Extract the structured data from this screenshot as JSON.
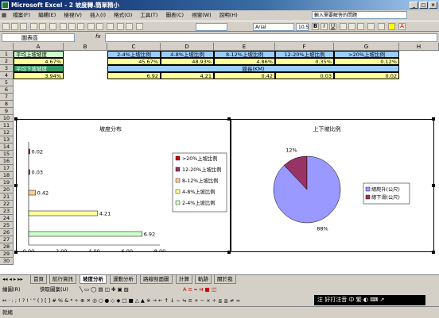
{
  "window": {
    "title": "Microsoft Excel - 2 坡度轉.簡單精小"
  },
  "menu": [
    "檔案(F)",
    "編輯(E)",
    "檢視(V)",
    "插入(I)",
    "格式(O)",
    "工具(T)",
    "圖表(C)",
    "視窗(W)",
    "說明(H)"
  ],
  "help_placeholder": "輸入需要解答的問題",
  "font": {
    "name": "Arial",
    "size": "10.5"
  },
  "namebox": "圖表區",
  "fx": "fx",
  "columns": [
    "A",
    "B",
    "C",
    "D",
    "E",
    "F",
    "G",
    "H"
  ],
  "rows": [
    "1",
    "2",
    "3",
    "4",
    "5",
    "6",
    "7",
    "8",
    "9",
    "10",
    "11",
    "12",
    "13",
    "14",
    "15",
    "16",
    "17",
    "18",
    "19",
    "20",
    "21",
    "22",
    "23",
    "24",
    "25",
    "26",
    "27",
    "28",
    "29",
    "30"
  ],
  "cells": {
    "a1": "平均上坡坡度",
    "a2": "4.67%",
    "a3": "平均下坡坡度",
    "a4": "3.94%",
    "c1": "2-4%上坡比例",
    "d1": "4-8%上坡比例",
    "e1": "8-12%上坡比例",
    "f1": "12-20%上坡比例",
    "g1": ">20%上坡比例",
    "c2": "45.67%",
    "d2": "48.93%",
    "e2": "4.86%",
    "f2": "0.35%",
    "g2": "0.12%",
    "e3": "總長(KM)",
    "c4": "6.92",
    "d4": "4.21",
    "e4": "0.42",
    "f4": "0.03",
    "g4": "0.02"
  },
  "chart_data": [
    {
      "type": "bar",
      "title": "坡度分布",
      "xlabel": "公里",
      "ylabel": "",
      "categories": [
        "2-4%上坡比例",
        "4-8%上坡比例",
        "8-12%上坡比例",
        "12-20%上坡比例",
        ">20%上坡比例"
      ],
      "values": [
        6.92,
        4.21,
        0.42,
        0.03,
        0.02
      ],
      "data_labels": [
        "6.92",
        "4.21",
        "0.42",
        "0.03",
        "0.02"
      ],
      "xlim": [
        0,
        8
      ],
      "xticks": [
        "0.00",
        "2.00",
        "4.00",
        "6.00",
        "8.00"
      ],
      "colors": [
        "#ccffcc",
        "#ffff99",
        "#ffcc99",
        "#993366",
        "#cc0000"
      ],
      "legend": {
        "position": "right",
        "entries": [
          ">20%上坡比例",
          "12-20%上坡比例",
          "8-12%上坡比例",
          "4-8%上坡比例",
          "2-4%上坡比例"
        ]
      },
      "grid": false
    },
    {
      "type": "pie",
      "title": "上下坡比例",
      "categories": [
        "總爬升(公尺)",
        "總下滑(公尺)"
      ],
      "values": [
        88,
        12
      ],
      "data_labels": [
        "88%",
        "12%"
      ],
      "colors": [
        "#9999ff",
        "#993366"
      ],
      "legend": {
        "position": "right",
        "entries": [
          "總爬升(公尺)",
          "總下滑(公尺)"
        ]
      }
    }
  ],
  "sheets": [
    "首頁",
    "航行資訊",
    "坡度分析",
    "運動分析",
    "路線剖面圖",
    "計算",
    "軌跡",
    "關於我"
  ],
  "active_sheet": 2,
  "drawbar": {
    "draw": "繪圖(R)",
    "autoshape": "快取圖案(U)"
  },
  "status": "就緒",
  "ime": "注 好打注音  中 繁 ◐ ⌨ ↗"
}
